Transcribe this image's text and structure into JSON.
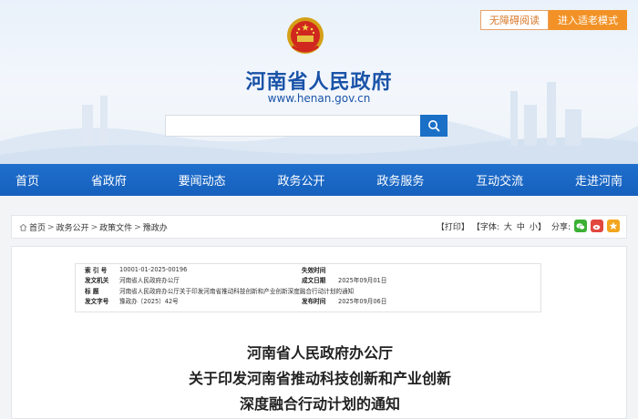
{
  "top_links": {
    "accessible": "无障碍阅读",
    "elder_mode": "进入适老模式"
  },
  "site": {
    "title": "河南省人民政府",
    "url": "www.henan.gov.cn"
  },
  "search": {
    "placeholder": "",
    "value": ""
  },
  "nav": [
    {
      "label": "首页"
    },
    {
      "label": "省政府"
    },
    {
      "label": "要闻动态"
    },
    {
      "label": "政务公开"
    },
    {
      "label": "政务服务"
    },
    {
      "label": "互动交流"
    },
    {
      "label": "走进河南"
    }
  ],
  "breadcrumb": [
    "首页",
    "政务公开",
    "政策文件",
    "豫政办"
  ],
  "tools": {
    "print": "【打印】",
    "font_label": "【字体:",
    "size_large": "大",
    "size_medium": "中",
    "size_small": "小",
    "font_end": "】",
    "share": "分享:"
  },
  "meta": {
    "index_label": "索 引 号",
    "index_value": "10001-01-2025-00196",
    "issuer_label": "发文机关",
    "issuer_value": "河南省人民政府办公厅",
    "subject_label": "标 题",
    "subject_value": "河南省人民政府办公厅关于印发河南省推动科技创新和产业创新深度融合行动计划的通知",
    "docno_label": "发文字号",
    "docno_value": "豫政办〔2025〕42号",
    "expiry_label": "失效时间",
    "expiry_value": "",
    "date_label": "成文日期",
    "date_value": "2025年09月01日",
    "publish_label": "发布时间",
    "publish_value": "2025年09月06日"
  },
  "article": {
    "title_lines": [
      "河南省人民政府办公厅",
      "关于印发河南省推动科技创新和产业创新",
      "深度融合行动计划的通知"
    ]
  },
  "colors": {
    "brand_blue": "#1a53a8",
    "nav_blue": "#1f6fcd",
    "accent_orange": "#f29226"
  }
}
